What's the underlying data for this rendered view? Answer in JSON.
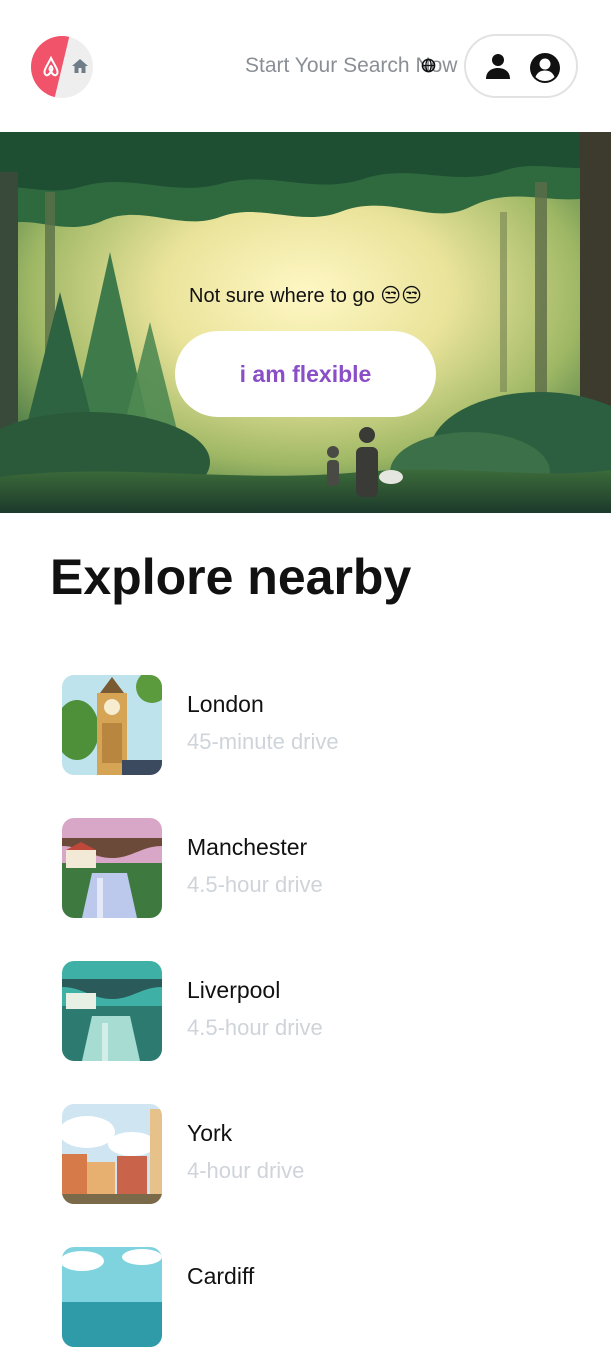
{
  "header": {
    "search_text": "Start Your Search Now"
  },
  "hero": {
    "tagline": "Not sure where to go 😒😒",
    "button_label": "i am flexible"
  },
  "explore": {
    "title": "Explore nearby",
    "items": [
      {
        "name": "London",
        "drive": "45-minute drive",
        "icon": "big-ben-illustration"
      },
      {
        "name": "Manchester",
        "drive": "4.5-hour drive",
        "icon": "bridge-canal-illustration"
      },
      {
        "name": "Liverpool",
        "drive": "4.5-hour drive",
        "icon": "bridge-canal-teal-illustration"
      },
      {
        "name": "York",
        "drive": "4-hour drive",
        "icon": "old-town-illustration"
      },
      {
        "name": "Cardiff",
        "drive": "",
        "icon": "coast-illustration"
      }
    ]
  },
  "colors": {
    "brand": "#f0536a",
    "accent": "#8a4fc7",
    "muted": "#cfd4da"
  }
}
